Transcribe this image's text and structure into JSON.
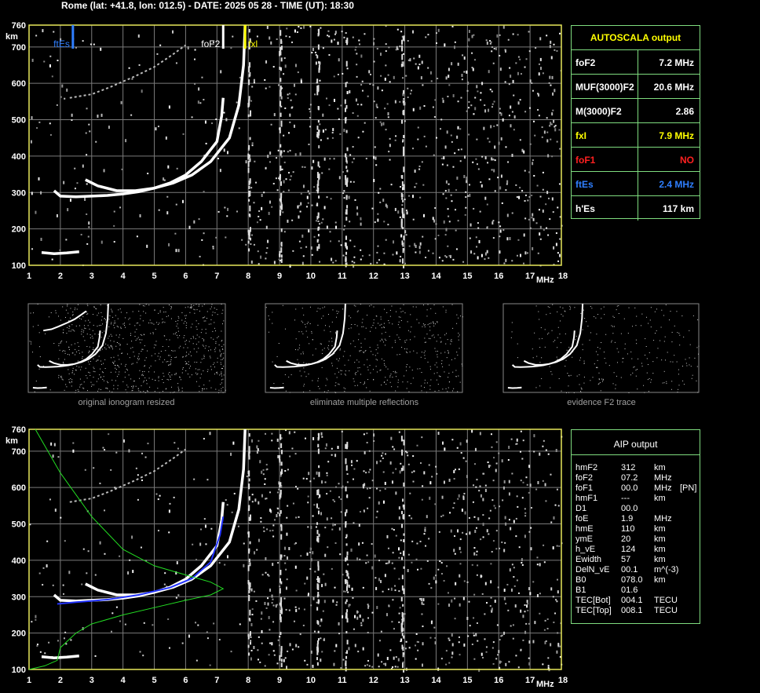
{
  "header": {
    "title": "Rome (lat: +41.8, lon: 012.5) - DATE: 2025 05 28 - TIME (UT): 18:30"
  },
  "colors": {
    "axis": "#e8e85a",
    "grid": "#7a7a7a",
    "panel_border": "#7fdc7f",
    "autoscala_title": "#ffff00",
    "ftes": "#2f7fff",
    "fxl": "#ffff00",
    "fof1": "#ff2020",
    "fof2_marker": "#ffffff",
    "profile": "#22dd22",
    "aip_trace": "#2233ff"
  },
  "chart_data": [
    {
      "type": "scatter",
      "id": "top-ionogram",
      "xlabel": "MHz",
      "ylabel": "km",
      "xlim": [
        1,
        18
      ],
      "ylim": [
        100,
        760
      ],
      "x_ticks": [
        1,
        2,
        3,
        4,
        5,
        6,
        7,
        8,
        9,
        10,
        11,
        12,
        13,
        14,
        15,
        16,
        17,
        18
      ],
      "y_ticks": [
        100,
        200,
        300,
        400,
        500,
        600,
        700,
        760
      ],
      "grid": true,
      "markers": [
        {
          "label": "ftEs",
          "x": 2.4,
          "color": "#2f7fff"
        },
        {
          "label": "foF2",
          "x": 7.2,
          "color": "#ffffff"
        },
        {
          "label": "fxl",
          "x": 7.9,
          "color": "#ffff00"
        }
      ],
      "traces": [
        {
          "name": "o-trace",
          "points": [
            [
              1.8,
              305
            ],
            [
              2.0,
              290
            ],
            [
              2.5,
              288
            ],
            [
              3.0,
              290
            ],
            [
              3.5,
              292
            ],
            [
              4.0,
              296
            ],
            [
              4.5,
              302
            ],
            [
              5.0,
              312
            ],
            [
              5.5,
              326
            ],
            [
              6.0,
              348
            ],
            [
              6.5,
              385
            ],
            [
              7.0,
              440
            ],
            [
              7.15,
              510
            ],
            [
              7.2,
              560
            ]
          ]
        },
        {
          "name": "x-trace",
          "points": [
            [
              2.8,
              335
            ],
            [
              3.2,
              318
            ],
            [
              3.8,
              305
            ],
            [
              4.4,
              305
            ],
            [
              5.0,
              312
            ],
            [
              5.6,
              326
            ],
            [
              6.2,
              348
            ],
            [
              6.8,
              385
            ],
            [
              7.4,
              450
            ],
            [
              7.7,
              540
            ],
            [
              7.85,
              650
            ],
            [
              7.9,
              760
            ]
          ]
        },
        {
          "name": "es-trace",
          "points": [
            [
              1.4,
              135
            ],
            [
              1.8,
              132
            ],
            [
              2.2,
              134
            ],
            [
              2.6,
              137
            ]
          ]
        },
        {
          "name": "multiple-reflection",
          "points": [
            [
              2.3,
              560
            ],
            [
              3.0,
              570
            ],
            [
              3.6,
              590
            ],
            [
              4.4,
              620
            ],
            [
              5.0,
              645
            ],
            [
              5.6,
              680
            ],
            [
              6.0,
              705
            ]
          ]
        }
      ]
    },
    {
      "type": "scatter",
      "id": "thumb-original",
      "caption": "original ionogram resized"
    },
    {
      "type": "scatter",
      "id": "thumb-eliminate",
      "caption": "eliminate multiple reflections"
    },
    {
      "type": "scatter",
      "id": "thumb-evidence",
      "caption": "evidence F2 trace"
    },
    {
      "type": "scatter",
      "id": "bottom-ionogram",
      "xlabel": "MHz",
      "ylabel": "km",
      "xlim": [
        1,
        18
      ],
      "ylim": [
        100,
        760
      ],
      "x_ticks": [
        1,
        2,
        3,
        4,
        5,
        6,
        7,
        8,
        9,
        10,
        11,
        12,
        13,
        14,
        15,
        16,
        17,
        18
      ],
      "y_ticks": [
        100,
        200,
        300,
        400,
        500,
        600,
        700,
        760
      ],
      "grid": true,
      "profile": [
        [
          1.0,
          100
        ],
        [
          1.5,
          110
        ],
        [
          1.9,
          125
        ],
        [
          2.0,
          160
        ],
        [
          2.5,
          200
        ],
        [
          3.0,
          225
        ],
        [
          4.0,
          250
        ],
        [
          5.0,
          270
        ],
        [
          6.0,
          290
        ],
        [
          6.8,
          305
        ],
        [
          7.2,
          322
        ],
        [
          6.8,
          340
        ],
        [
          6.0,
          360
        ],
        [
          5.0,
          385
        ],
        [
          4.0,
          430
        ],
        [
          3.0,
          520
        ],
        [
          2.0,
          640
        ],
        [
          1.2,
          760
        ]
      ],
      "aip_trace": [
        [
          1.9,
          280
        ],
        [
          2.5,
          285
        ],
        [
          3.5,
          292
        ],
        [
          4.5,
          305
        ],
        [
          5.5,
          325
        ],
        [
          6.2,
          350
        ],
        [
          6.8,
          395
        ],
        [
          7.1,
          470
        ],
        [
          7.2,
          520
        ]
      ]
    }
  ],
  "autoscala": {
    "title": "AUTOSCALA output",
    "rows": [
      {
        "key": "foF2",
        "value": "7.2 MHz",
        "color": "#ffffff"
      },
      {
        "key": "MUF(3000)F2",
        "value": "20.6 MHz",
        "color": "#ffffff"
      },
      {
        "key": "M(3000)F2",
        "value": "2.86",
        "color": "#ffffff"
      },
      {
        "key": "fxI",
        "value": "7.9 MHz",
        "color": "#ffff00"
      },
      {
        "key": "foF1",
        "value": "NO",
        "color": "#ff2020"
      },
      {
        "key": "ftEs",
        "value": "2.4 MHz",
        "color": "#2f7fff"
      },
      {
        "key": "h'Es",
        "value": "117    km",
        "color": "#ffffff"
      }
    ]
  },
  "aip": {
    "title": "AIP output",
    "rows": [
      {
        "key": "hmF2",
        "value": "312",
        "unit": "km",
        "extra": ""
      },
      {
        "key": "foF2",
        "value": "07.2",
        "unit": "MHz",
        "extra": ""
      },
      {
        "key": "foF1",
        "value": "00.0",
        "unit": "MHz",
        "extra": "[PN]"
      },
      {
        "key": "hmF1",
        "value": "---",
        "unit": "km",
        "extra": ""
      },
      {
        "key": "D1",
        "value": "00.0",
        "unit": "",
        "extra": ""
      },
      {
        "key": "foE",
        "value": "1.9",
        "unit": "MHz",
        "extra": ""
      },
      {
        "key": "hmE",
        "value": "110",
        "unit": "km",
        "extra": ""
      },
      {
        "key": "ymE",
        "value": "20",
        "unit": "km",
        "extra": ""
      },
      {
        "key": "h_vE",
        "value": "124",
        "unit": "km",
        "extra": ""
      },
      {
        "key": "Ewidth",
        "value": "57",
        "unit": "km",
        "extra": ""
      },
      {
        "key": "DelN_vE",
        "value": "00.1",
        "unit": "m^(-3)",
        "extra": ""
      },
      {
        "key": "B0",
        "value": "078.0",
        "unit": "km",
        "extra": ""
      },
      {
        "key": "B1",
        "value": "01.6",
        "unit": "",
        "extra": ""
      },
      {
        "key": "TEC[Bot]",
        "value": "004.1",
        "unit": "TECU",
        "extra": ""
      },
      {
        "key": "TEC[Top]",
        "value": "008.1",
        "unit": "TECU",
        "extra": ""
      }
    ]
  }
}
